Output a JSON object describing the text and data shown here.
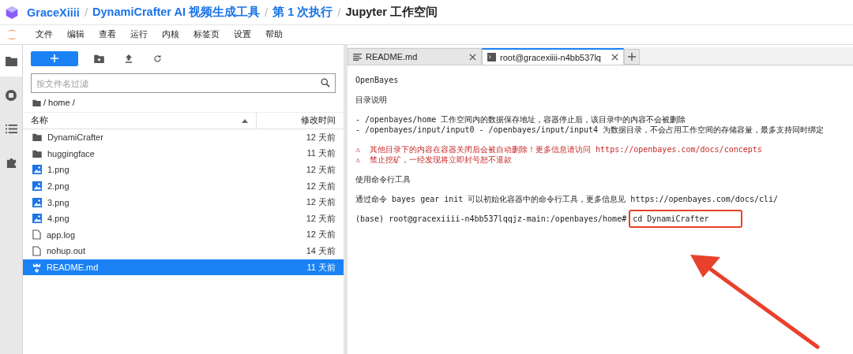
{
  "breadcrumb_separator": "/",
  "breadcrumb": [
    {
      "label": "GraceXiiii",
      "current": false
    },
    {
      "label": "DynamiCrafter AI 视频生成工具",
      "current": false
    },
    {
      "label": "第 1 次执行",
      "current": false
    },
    {
      "label": "Jupyter 工作空间",
      "current": true
    }
  ],
  "menu": [
    "文件",
    "编辑",
    "查看",
    "运行",
    "内核",
    "标签页",
    "设置",
    "帮助"
  ],
  "file_browser": {
    "filter": {
      "placeholder": "按文件名过滤"
    },
    "path": "/ home /",
    "columns": [
      {
        "label": "名称",
        "sorted": true
      },
      {
        "label": "修改时间",
        "sorted": false
      }
    ],
    "files": [
      {
        "name": "DynamiCrafter",
        "kind": "folder",
        "modified": "12 天前",
        "selected": false
      },
      {
        "name": "huggingface",
        "kind": "folder",
        "modified": "11 天前",
        "selected": false
      },
      {
        "name": "1.png",
        "kind": "image",
        "modified": "12 天前",
        "selected": false
      },
      {
        "name": "2.png",
        "kind": "image",
        "modified": "12 天前",
        "selected": false
      },
      {
        "name": "3.png",
        "kind": "image",
        "modified": "12 天前",
        "selected": false
      },
      {
        "name": "4.png",
        "kind": "image",
        "modified": "12 天前",
        "selected": false
      },
      {
        "name": "app.log",
        "kind": "file",
        "modified": "12 天前",
        "selected": false
      },
      {
        "name": "nohup.out",
        "kind": "file",
        "modified": "14 天前",
        "selected": false
      },
      {
        "name": "README.md",
        "kind": "markdown",
        "modified": "11 天前",
        "selected": true
      }
    ]
  },
  "tabs": [
    {
      "label": "README.md",
      "kind": "markdown",
      "selected": false
    },
    {
      "label": "root@gracexiiii-n4bb537lq",
      "kind": "terminal",
      "selected": true
    }
  ],
  "terminal": [
    {
      "kind": "text",
      "text": "OpenBayes"
    },
    {
      "kind": "text",
      "text": "目录说明"
    },
    {
      "kind": "text",
      "text": "- /openbayes/home 工作空间内的数据保存地址，容器停止后，该目录中的内容不会被删除\n- /openbayes/input/input0 - /openbayes/input/input4 为数据目录，不会占用工作空间的存储容量，最多支持同时绑定"
    },
    {
      "kind": "warning",
      "text": "⚠  其他目录下的内容在容器关闭后会被自动删除！更多信息请访问 https://openbayes.com/docs/concepts\n⚠  禁止挖矿，一经发现将立即封号恕不退款"
    },
    {
      "kind": "text",
      "text": "使用命令行工具"
    },
    {
      "kind": "text",
      "text": "通过命令 bayes gear init 可以初始化容器中的命令行工具，更多信息见 https://openbayes.com/docs/cli/"
    },
    {
      "kind": "prompt",
      "prompt": "(base) root@gracexiiii-n4bb537lqqjz-main:/openbayes/home#",
      "command": "cd DynamiCrafter",
      "highlighted": true
    }
  ]
}
